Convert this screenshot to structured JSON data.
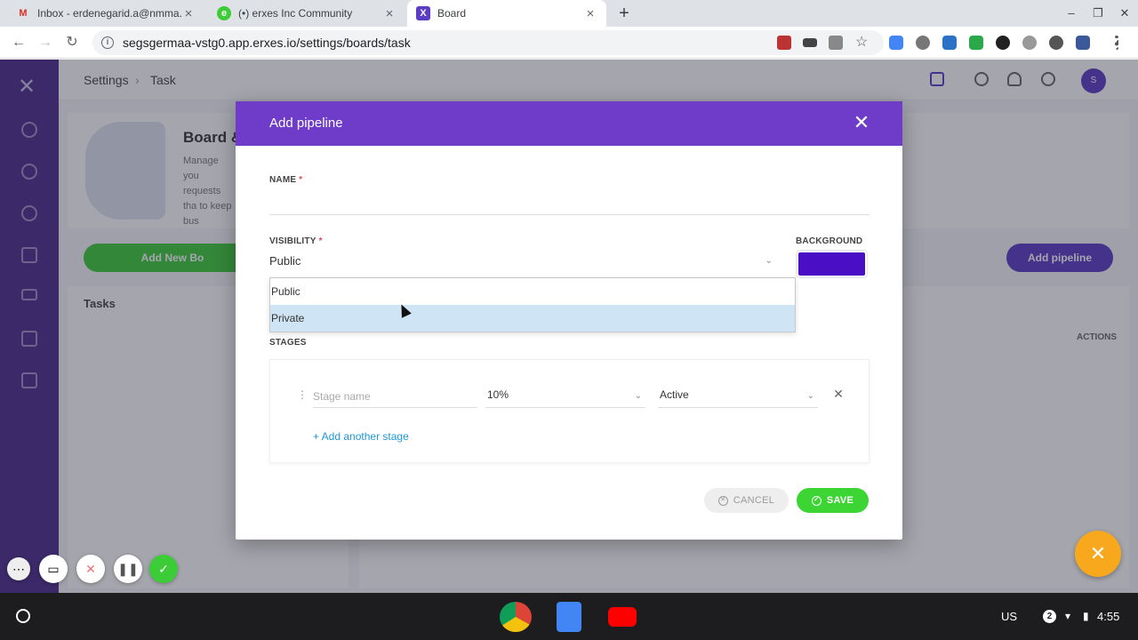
{
  "browser": {
    "tabs": [
      {
        "favicon": "M",
        "title": "Inbox - erdenegarid.a@nmma.co"
      },
      {
        "favicon": "e",
        "title": "(•) erxes Inc Community"
      },
      {
        "favicon": "X",
        "title": "Board"
      }
    ],
    "url": "segsgermaa-vstg0.app.erxes.io/settings/boards/task"
  },
  "app": {
    "breadcrumb": [
      "Settings",
      "›",
      "Task"
    ],
    "avatar_initial": "S",
    "hero_title": "Board &",
    "hero_desc": "Manage you requests tha to keep bus",
    "add_board_label": "Add New Bo",
    "add_pipeline_label": "Add pipeline",
    "left_panel_title": "Tasks",
    "actions_header": "ACTIONS"
  },
  "modal": {
    "title": "Add pipeline",
    "name_label": "NAME",
    "required_mark": "*",
    "name_value": "",
    "visibility_label": "VISIBILITY",
    "visibility_value": "Public",
    "visibility_options": [
      "Public",
      "Private"
    ],
    "highlighted_option": "Private",
    "background_label": "BACKGROUND",
    "background_color": "#4a0fc4",
    "stages_label": "STAGES",
    "stage": {
      "name_placeholder": "Stage name",
      "probability": "10%",
      "status": "Active"
    },
    "add_stage_label": "+ Add another stage",
    "cancel_label": "CANCEL",
    "save_label": "SAVE"
  },
  "shelf": {
    "locale": "US",
    "notifications": "2",
    "time": "4:55"
  },
  "colors": {
    "header_purple": "#6e3cc8",
    "sidebar_purple": "#4a2a8a",
    "save_green": "#3cd534",
    "link_blue": "#1f97d7",
    "fab_orange": "#f8a81d"
  }
}
